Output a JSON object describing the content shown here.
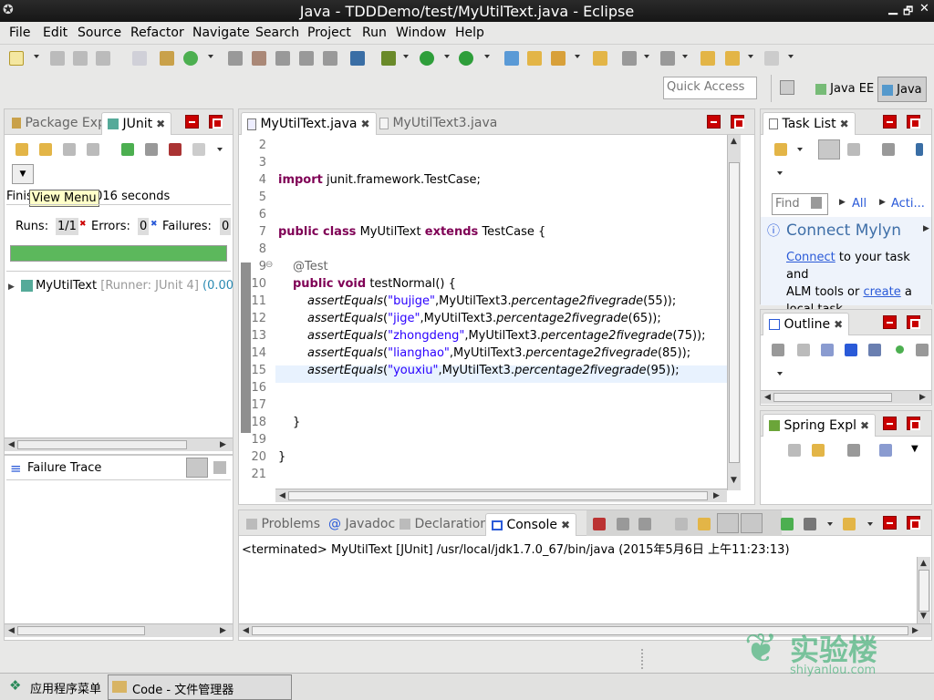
{
  "window": {
    "title": "Java - TDDDemo/test/MyUtilText.java - Eclipse"
  },
  "menu": [
    "File",
    "Edit",
    "Source",
    "Refactor",
    "Navigate",
    "Search",
    "Project",
    "Run",
    "Window",
    "Help"
  ],
  "quick_access": {
    "placeholder": "Quick Access"
  },
  "perspectives": [
    "Java EE",
    "Java"
  ],
  "left_panel": {
    "tabs": [
      "Package Exp",
      "JUnit"
    ],
    "tooltip": "View Menu",
    "finished_prefix": "Finis",
    "finished_suffix": ".016 seconds",
    "runs_label": "Runs:",
    "runs_value": "1/1",
    "errors_label": "Errors:",
    "errors_value": "0",
    "failures_label": "Failures:",
    "failures_value": "0",
    "progress": 1.0,
    "bar_color": "#5cb85c",
    "tree_item": "MyUtilText",
    "tree_runner": "[Runner: JUnit 4]",
    "tree_time": "(0.00",
    "failure_trace": "Failure Trace"
  },
  "editor": {
    "tabs": [
      "MyUtilText.java",
      "MyUtilText3.java"
    ],
    "lines": [
      {
        "n": "2",
        "text": ""
      },
      {
        "n": "3",
        "text": ""
      },
      {
        "n": "4",
        "kw": "import",
        "rest": "junit.framework.TestCase;"
      },
      {
        "n": "5",
        "text": ""
      },
      {
        "n": "6",
        "text": ""
      },
      {
        "n": "7",
        "kw": "public class",
        "name": "MyUtilText",
        "kw2": "extends",
        "rest": "TestCase {"
      },
      {
        "n": "8",
        "text": ""
      },
      {
        "n": "9",
        "annotation": "@Test"
      },
      {
        "n": "10",
        "kw": "public void",
        "rest": "testNormal() {"
      },
      {
        "n": "11",
        "call": "assertEquals",
        "str": "\"bujige\"",
        "cls": ",MyUtilText3.",
        "m": "percentage2fivegrade",
        "arg": "(55));"
      },
      {
        "n": "12",
        "call": "assertEquals",
        "str": "\"jige\"",
        "cls": ",MyUtilText3.",
        "m": "percentage2fivegrade",
        "arg": "(65));"
      },
      {
        "n": "13",
        "call": "assertEquals",
        "str": "\"zhongdeng\"",
        "cls": ",MyUtilText3.",
        "m": "percentage2fivegrade",
        "arg": "(75));"
      },
      {
        "n": "14",
        "call": "assertEquals",
        "str": "\"lianghao\"",
        "cls": ",MyUtilText3.",
        "m": "percentage2fivegrade",
        "arg": "(85));"
      },
      {
        "n": "15",
        "call": "assertEquals",
        "str": "\"youxiu\"",
        "cls": ",MyUtilText3.",
        "m": "percentage2fivegrade",
        "arg": "(95));"
      },
      {
        "n": "16",
        "text": ""
      },
      {
        "n": "17",
        "text": ""
      },
      {
        "n": "18",
        "text": "}"
      },
      {
        "n": "19",
        "text": ""
      },
      {
        "n": "20",
        "text": "}"
      },
      {
        "n": "21",
        "text": ""
      }
    ]
  },
  "right_panels": {
    "task_list": {
      "tab": "Task List",
      "find_placeholder": "Find",
      "all": "All",
      "acti": "Acti..."
    },
    "mylyn": {
      "title": "Connect Mylyn",
      "connect": "Connect",
      "text1": " to your task and",
      "text2": "ALM tools or ",
      "create": "create",
      "text3": " a",
      "text4": "local task."
    },
    "outline": {
      "tab": "Outline"
    },
    "spring": {
      "tab": "Spring Expl"
    }
  },
  "bottom": {
    "tabs": [
      "Problems",
      "Javadoc",
      "Declaration",
      "Console"
    ],
    "console_text": "<terminated> MyUtilText [JUnit] /usr/local/jdk1.7.0_67/bin/java (2015年5月6日 上午11:23:13)"
  },
  "taskbar": {
    "app_menu": "应用程序菜单",
    "window": "Code - 文件管理器"
  },
  "watermark": {
    "brand": "实验楼",
    "url": "shiyanlou.com"
  }
}
